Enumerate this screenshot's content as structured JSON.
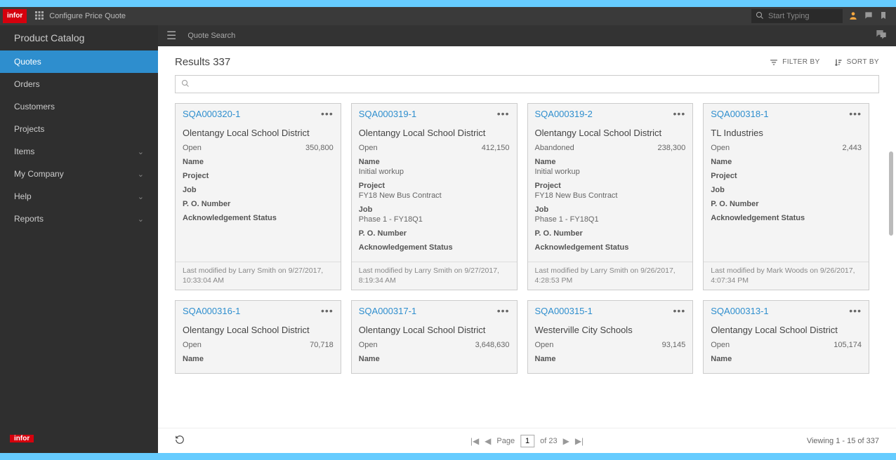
{
  "top": {
    "logo": "infor",
    "title": "Configure Price Quote",
    "search_placeholder": "Start Typing"
  },
  "sidebar": {
    "title": "Product Catalog",
    "items": [
      {
        "label": "Quotes",
        "active": true,
        "expand": false
      },
      {
        "label": "Orders",
        "active": false,
        "expand": false
      },
      {
        "label": "Customers",
        "active": false,
        "expand": false
      },
      {
        "label": "Projects",
        "active": false,
        "expand": false
      },
      {
        "label": "Items",
        "active": false,
        "expand": true
      },
      {
        "label": "My Company",
        "active": false,
        "expand": true
      },
      {
        "label": "Help",
        "active": false,
        "expand": true
      },
      {
        "label": "Reports",
        "active": false,
        "expand": true
      }
    ],
    "bottom_logo": "infor"
  },
  "mainbar": {
    "title": "Quote Search"
  },
  "content": {
    "results_label": "Results",
    "results_count": "337",
    "filter_by": "FILTER BY",
    "sort_by": "SORT BY",
    "field_labels": {
      "name": "Name",
      "project": "Project",
      "job": "Job",
      "po": "P. O. Number",
      "ack": "Acknowledgement Status",
      "modified_prefix": "Last modified by"
    },
    "cards": [
      {
        "id": "SQA000320-1",
        "customer": "Olentangy Local School District",
        "status": "Open",
        "amount": "350,800",
        "name": "",
        "project": "",
        "job": "",
        "po": "",
        "ack": "",
        "modified": "Last modified by Larry Smith on 9/27/2017, 10:33:04 AM"
      },
      {
        "id": "SQA000319-1",
        "customer": "Olentangy Local School District",
        "status": "Open",
        "amount": "412,150",
        "name": "Initial workup",
        "project": "FY18 New Bus Contract",
        "job": "Phase 1 - FY18Q1",
        "po": "",
        "ack": "",
        "modified": "Last modified by Larry Smith on 9/27/2017, 8:19:34 AM"
      },
      {
        "id": "SQA000319-2",
        "customer": "Olentangy Local School District",
        "status": "Abandoned",
        "amount": "238,300",
        "name": "Initial workup",
        "project": "FY18 New Bus Contract",
        "job": "Phase 1 - FY18Q1",
        "po": "",
        "ack": "",
        "modified": "Last modified by Larry Smith on 9/26/2017, 4:28:53 PM"
      },
      {
        "id": "SQA000318-1",
        "customer": "TL Industries",
        "status": "Open",
        "amount": "2,443",
        "name": "",
        "project": "",
        "job": "",
        "po": "",
        "ack": "",
        "modified": "Last modified by Mark Woods on 9/26/2017, 4:07:34 PM"
      },
      {
        "id": "SQA000316-1",
        "customer": "Olentangy Local School District",
        "status": "Open",
        "amount": "70,718",
        "name": ""
      },
      {
        "id": "SQA000317-1",
        "customer": "Olentangy Local School District",
        "status": "Open",
        "amount": "3,648,630",
        "name": ""
      },
      {
        "id": "SQA000315-1",
        "customer": "Westerville City Schools",
        "status": "Open",
        "amount": "93,145",
        "name": ""
      },
      {
        "id": "SQA000313-1",
        "customer": "Olentangy Local School District",
        "status": "Open",
        "amount": "105,174",
        "name": ""
      }
    ]
  },
  "pager": {
    "page_label": "Page",
    "page_value": "1",
    "of_label": "of 23",
    "viewing": "Viewing 1 - 15 of 337"
  }
}
